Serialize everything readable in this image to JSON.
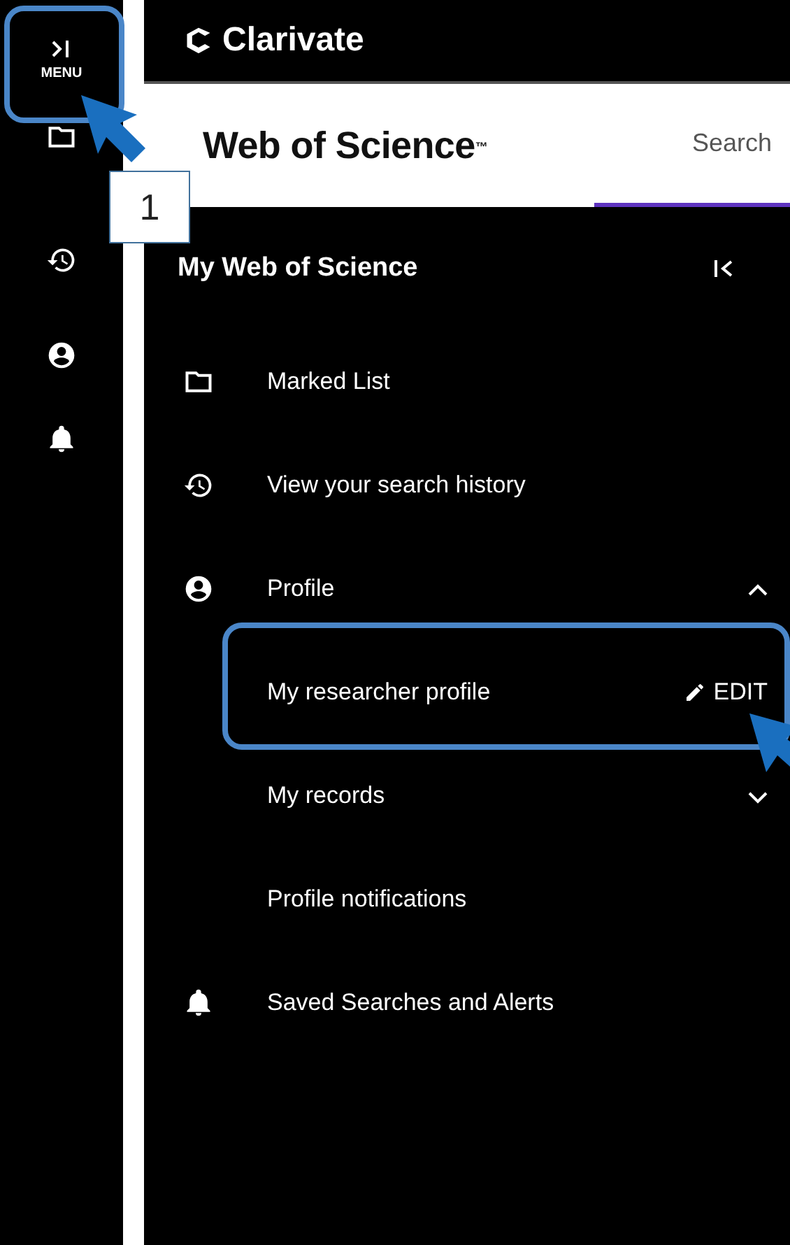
{
  "brand": {
    "name": "Clarivate"
  },
  "header": {
    "title": "Web of Science$^{™}$",
    "tabs": [
      {
        "label": "Search",
        "selected": true
      }
    ]
  },
  "rail": {
    "menu_label": "MENU"
  },
  "panel": {
    "title": "My Web of Science",
    "items": [
      {
        "label": "Marked List"
      },
      {
        "label": "View your search history"
      },
      {
        "label": "Profile",
        "expanded": true,
        "children": [
          {
            "label": "My researcher profile",
            "action": "EDIT"
          },
          {
            "label": "My records",
            "expanded": false
          },
          {
            "label": "Profile notifications"
          }
        ]
      },
      {
        "label": "Saved Searches and Alerts"
      }
    ]
  },
  "callouts": [
    {
      "label": "1"
    }
  ]
}
